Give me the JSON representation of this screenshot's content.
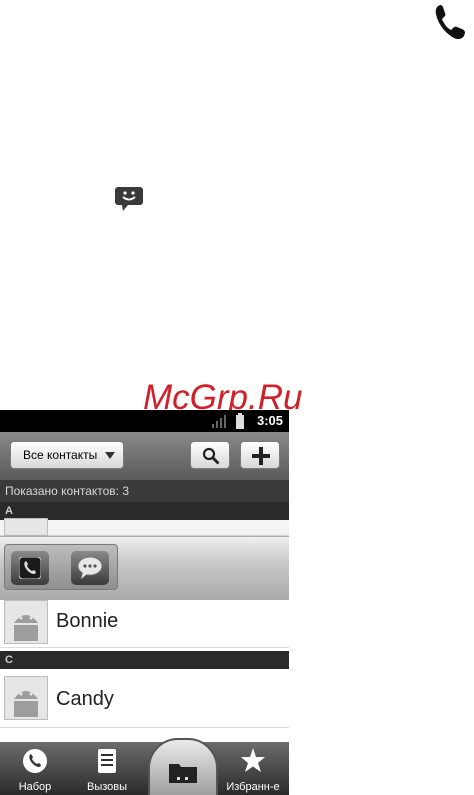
{
  "watermark": "McGrp.Ru",
  "icons": {
    "phone": "phone-icon",
    "sms": "sms-icon"
  },
  "status_bar": {
    "time": "3:05",
    "signal_icon": "signal-icon",
    "battery_icon": "battery-icon"
  },
  "toolbar": {
    "filter_label": "Все контакты",
    "search_icon": "search-icon",
    "add_icon": "plus-icon"
  },
  "contact_count": "Показано контактов: 3",
  "sections": [
    {
      "letter": "A"
    },
    {
      "letter": "C"
    }
  ],
  "contacts": [
    {
      "name": "Bonnie"
    },
    {
      "name": "Candy"
    }
  ],
  "quick_contact": {
    "call_icon": "phone-icon",
    "message_icon": "chat-icon"
  },
  "nav_tabs": [
    {
      "label": "Набор",
      "icon": "dialer-icon"
    },
    {
      "label": "Вызовы",
      "icon": "call-log-icon"
    },
    {
      "label": "",
      "icon": "contacts-folder-icon"
    },
    {
      "label": "Избранн-е",
      "icon": "star-icon"
    }
  ],
  "colors": {
    "watermark": "#d0202a",
    "accent_dark": "#2a2a2a"
  }
}
